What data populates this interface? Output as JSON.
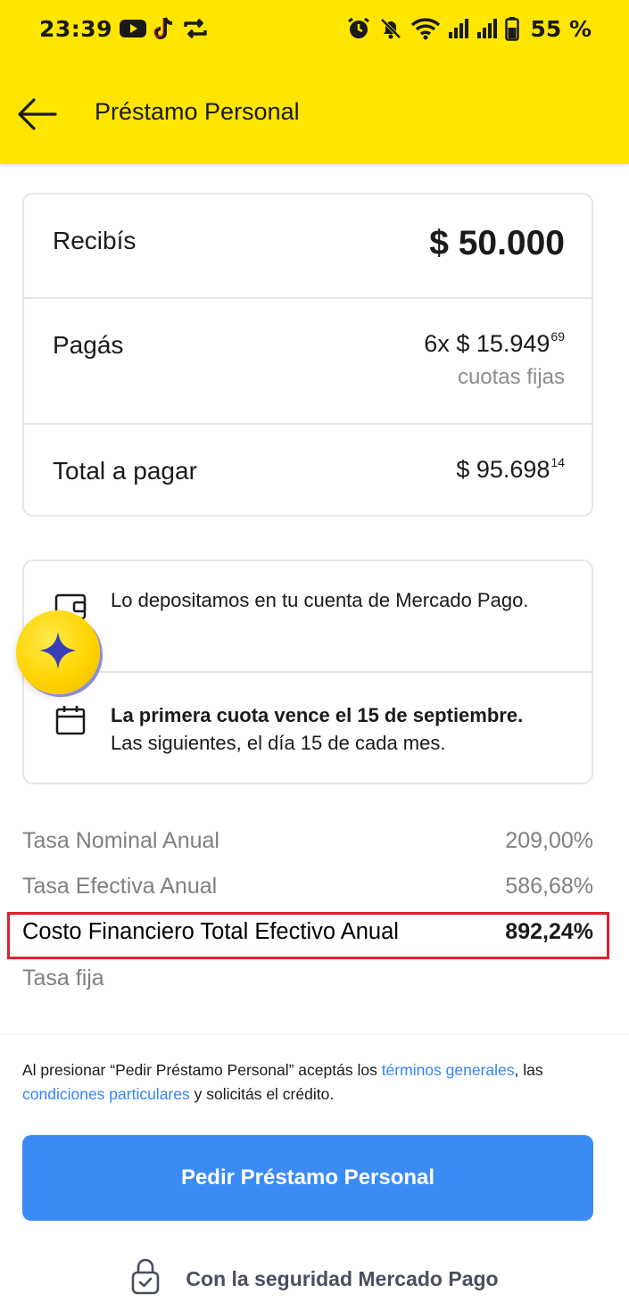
{
  "status_bar": {
    "time": "23:39",
    "battery_percent": "55 %",
    "icons": [
      "youtube-icon",
      "tiktok-icon",
      "sync-icon",
      "alarm-icon",
      "notifications-off-icon",
      "wifi-icon",
      "signal-icon",
      "signal-icon",
      "battery-icon"
    ]
  },
  "appbar": {
    "title": "Préstamo Personal",
    "back_icon": "arrow-left-icon"
  },
  "summary": {
    "receive_label": "Recibís",
    "receive_amount": "$ 50.000",
    "pay_label": "Pagás",
    "pay_installments": "6x $ 15.949",
    "pay_cents": "69",
    "pay_note": "cuotas fijas",
    "total_label": "Total a pagar",
    "total_amount": "$ 95.698",
    "total_cents": "14"
  },
  "info": {
    "deposit_text": "Lo depositamos en tu cuenta de Mercado Pago.",
    "deposit_icon": "wallet-icon",
    "due_title": "La primera cuota vence el 15 de septiembre.",
    "due_sub": "Las siguientes, el día 15 de cada mes.",
    "due_icon": "calendar-icon",
    "assistant_icon": "sparkle-icon"
  },
  "rates": {
    "tna_label": "Tasa Nominal Anual",
    "tna_value": "209,00%",
    "tea_label": "Tasa Efectiva Anual",
    "tea_value": "586,68%",
    "cftea_label": "Costo Financiero Total Efectivo Anual",
    "cftea_value": "892,24%",
    "fixed_rate_label": "Tasa fija"
  },
  "legal": {
    "prefix": "Al presionar “Pedir Préstamo Personal” aceptás los ",
    "link_terms": "términos generales",
    "middle": ", las ",
    "link_conditions": "condiciones particulares",
    "suffix": " y solicitás el crédito."
  },
  "cta": {
    "label": "Pedir Préstamo Personal"
  },
  "security": {
    "label": "Con la seguridad Mercado Pago",
    "icon": "lock-icon"
  },
  "colors": {
    "header_bg": "#ffe600",
    "primary_button": "#3b8bf5",
    "link": "#3483fa",
    "highlight": "#e0202a"
  }
}
